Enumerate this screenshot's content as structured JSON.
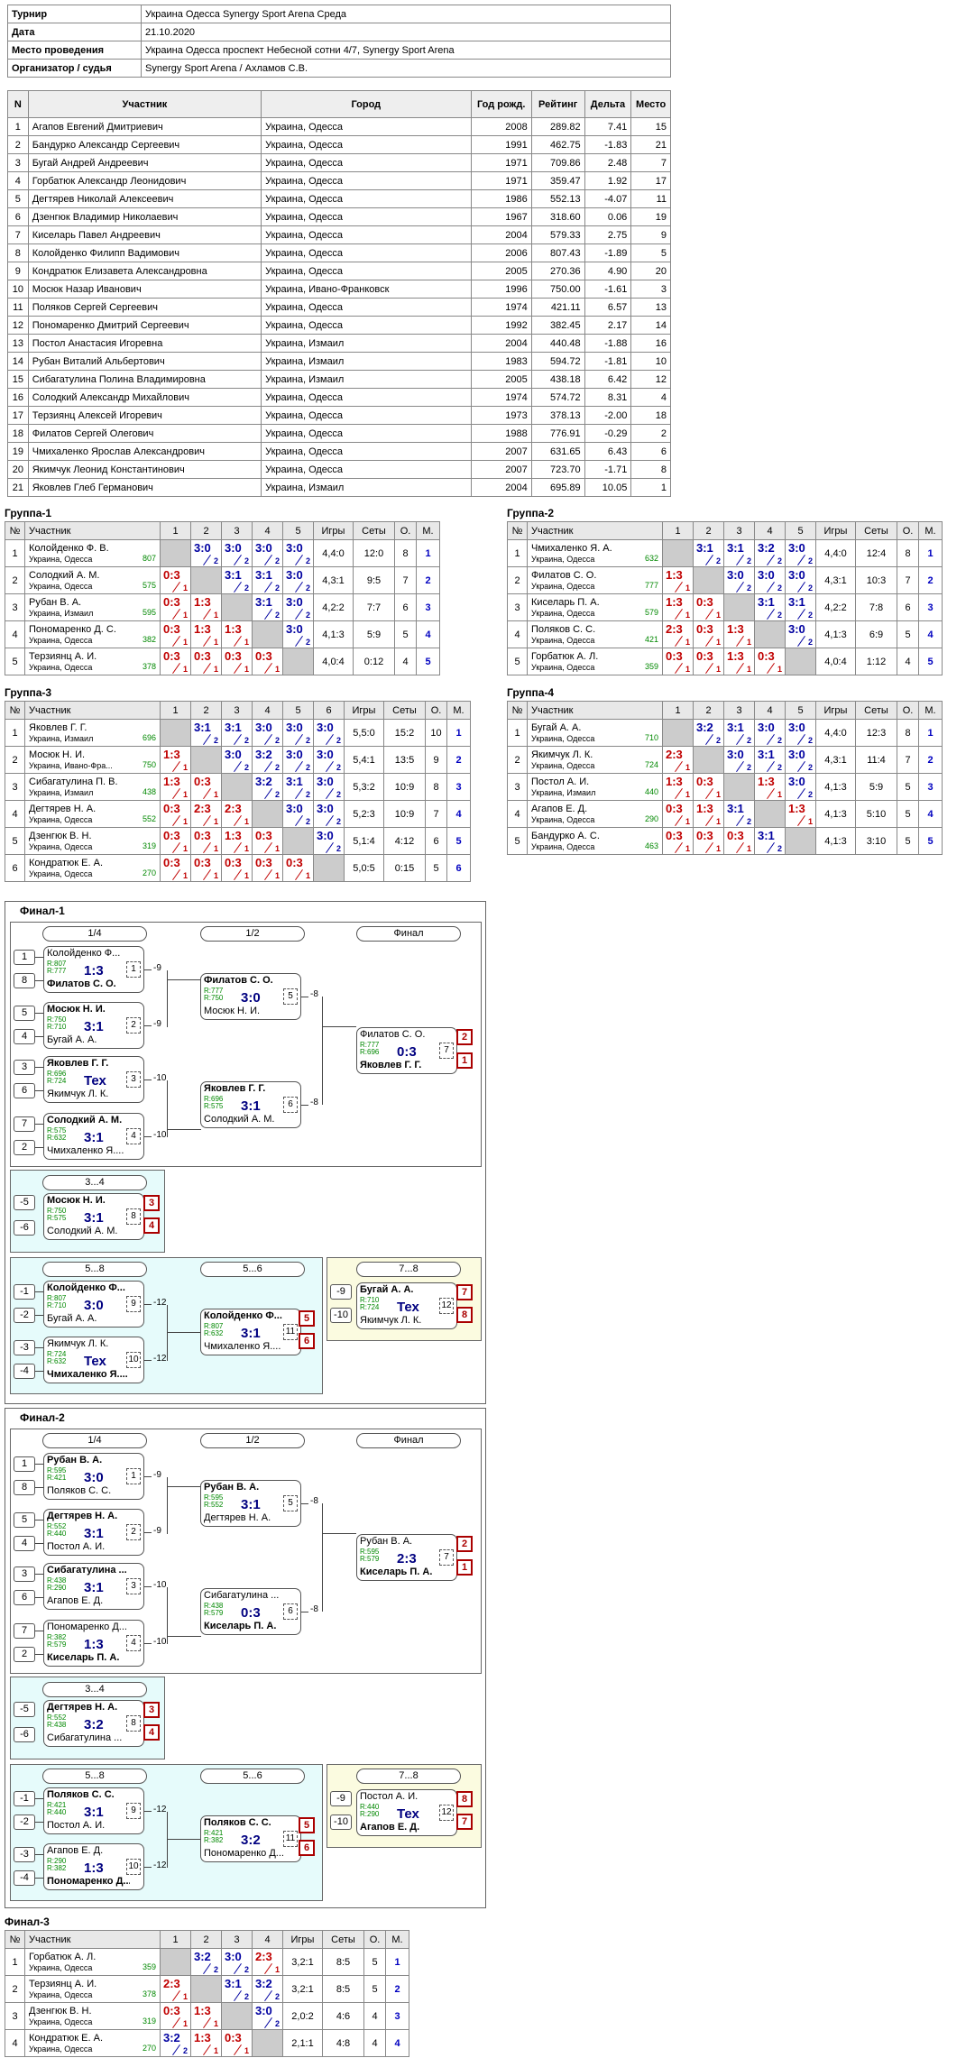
{
  "info": [
    [
      "Турнир",
      "Украина Одесса Synergy Sport Arena Среда"
    ],
    [
      "Дата",
      "21.10.2020"
    ],
    [
      "Место проведения",
      "Украина Одесса проспект Небесной сотни 4/7, Synergy Sport Arena"
    ],
    [
      "Организатор / судья",
      "Synergy Sport Arena / Ахламов С.В."
    ]
  ],
  "participants_header": [
    "N",
    "Участник",
    "Город",
    "Год рожд.",
    "Рейтинг",
    "Дельта",
    "Место"
  ],
  "participants": [
    [
      "1",
      "Агапов Евгений Дмитриевич",
      "Украина, Одесса",
      "2008",
      "289.82",
      "7.41",
      "15"
    ],
    [
      "2",
      "Бандурко Александр Сергеевич",
      "Украина, Одесса",
      "1991",
      "462.75",
      "-1.83",
      "21"
    ],
    [
      "3",
      "Бугай Андрей Андреевич",
      "Украина, Одесса",
      "1971",
      "709.86",
      "2.48",
      "7"
    ],
    [
      "4",
      "Горбатюк Александр Леонидович",
      "Украина, Одесса",
      "1971",
      "359.47",
      "1.92",
      "17"
    ],
    [
      "5",
      "Дегтярев Николай Алексеевич",
      "Украина, Одесса",
      "1986",
      "552.13",
      "-4.07",
      "11"
    ],
    [
      "6",
      "Дзенгюк Владимир Николаевич",
      "Украина, Одесса",
      "1967",
      "318.60",
      "0.06",
      "19"
    ],
    [
      "7",
      "Киселарь Павел Андреевич",
      "Украина, Одесса",
      "2004",
      "579.33",
      "2.75",
      "9"
    ],
    [
      "8",
      "Колойденко Филипп Вадимович",
      "Украина, Одесса",
      "2006",
      "807.43",
      "-1.89",
      "5"
    ],
    [
      "9",
      "Кондратюк Елизавета Александровна",
      "Украина, Одесса",
      "2005",
      "270.36",
      "4.90",
      "20"
    ],
    [
      "10",
      "Мосюк Назар Иванович",
      "Украина, Ивано-Франковск",
      "1996",
      "750.00",
      "-1.61",
      "3"
    ],
    [
      "11",
      "Поляков Сергей Сергеевич",
      "Украина, Одесса",
      "1974",
      "421.11",
      "6.57",
      "13"
    ],
    [
      "12",
      "Пономаренко Дмитрий Сергеевич",
      "Украина, Одесса",
      "1992",
      "382.45",
      "2.17",
      "14"
    ],
    [
      "13",
      "Постол Анастасия Игоревна",
      "Украина, Измаил",
      "2004",
      "440.48",
      "-1.88",
      "16"
    ],
    [
      "14",
      "Рубан Виталий Альбертович",
      "Украина, Измаил",
      "1983",
      "594.72",
      "-1.81",
      "10"
    ],
    [
      "15",
      "Сибагатулина Полина Владимировна",
      "Украина, Измаил",
      "2005",
      "438.18",
      "6.42",
      "12"
    ],
    [
      "16",
      "Солодкий Александр Михайлович",
      "Украина, Одесса",
      "1974",
      "574.72",
      "8.31",
      "4"
    ],
    [
      "17",
      "Терзиянц Алексей Игоревич",
      "Украина, Одесса",
      "1973",
      "378.13",
      "-2.00",
      "18"
    ],
    [
      "18",
      "Филатов Сергей Олегович",
      "Украина, Одесса",
      "1988",
      "776.91",
      "-0.29",
      "2"
    ],
    [
      "19",
      "Чмихаленко Ярослав Александрович",
      "Украина, Одесса",
      "2007",
      "631.65",
      "6.43",
      "6"
    ],
    [
      "20",
      "Якимчук Леонид Константинович",
      "Украина, Одесса",
      "2007",
      "723.70",
      "-1.71",
      "8"
    ],
    [
      "21",
      "Яковлев Глеб Германович",
      "Украина, Измаил",
      "2004",
      "695.89",
      "10.05",
      "1"
    ]
  ],
  "group_cols": {
    "num": "№",
    "name": "Участник",
    "games": "Игры",
    "sets": "Сеты",
    "points": "О.",
    "place": "М."
  },
  "groups": [
    {
      "title": "Группа-1",
      "rows": [
        {
          "n": "1",
          "name": "Колойденко Ф. В.",
          "city": "Украина, Одесса",
          "r": "807",
          "res": [
            null,
            "3:0",
            "3:0",
            "3:0",
            "3:0"
          ],
          "games": "4,4:0",
          "sets": "12:0",
          "pts": "8",
          "place": "1"
        },
        {
          "n": "2",
          "name": "Солодкий А. М.",
          "city": "Украина, Одесса",
          "r": "575",
          "res": [
            "0:3",
            null,
            "3:1",
            "3:1",
            "3:0"
          ],
          "games": "4,3:1",
          "sets": "9:5",
          "pts": "7",
          "place": "2"
        },
        {
          "n": "3",
          "name": "Рубан В. А.",
          "city": "Украина, Измаил",
          "r": "595",
          "res": [
            "0:3",
            "1:3",
            null,
            "3:1",
            "3:0"
          ],
          "games": "4,2:2",
          "sets": "7:7",
          "pts": "6",
          "place": "3"
        },
        {
          "n": "4",
          "name": "Пономаренко Д. С.",
          "city": "Украина, Одесса",
          "r": "382",
          "res": [
            "0:3",
            "1:3",
            "1:3",
            null,
            "3:0"
          ],
          "games": "4,1:3",
          "sets": "5:9",
          "pts": "5",
          "place": "4"
        },
        {
          "n": "5",
          "name": "Терзиянц А. И.",
          "city": "Украина, Одесса",
          "r": "378",
          "res": [
            "0:3",
            "0:3",
            "0:3",
            "0:3",
            null
          ],
          "games": "4,0:4",
          "sets": "0:12",
          "pts": "4",
          "place": "5"
        }
      ]
    },
    {
      "title": "Группа-2",
      "rows": [
        {
          "n": "1",
          "name": "Чмихаленко Я. А.",
          "city": "Украина, Одесса",
          "r": "632",
          "res": [
            null,
            "3:1",
            "3:1",
            "3:2",
            "3:0"
          ],
          "games": "4,4:0",
          "sets": "12:4",
          "pts": "8",
          "place": "1"
        },
        {
          "n": "2",
          "name": "Филатов С. О.",
          "city": "Украина, Одесса",
          "r": "777",
          "res": [
            "1:3",
            null,
            "3:0",
            "3:0",
            "3:0"
          ],
          "games": "4,3:1",
          "sets": "10:3",
          "pts": "7",
          "place": "2"
        },
        {
          "n": "3",
          "name": "Киселарь П. А.",
          "city": "Украина, Одесса",
          "r": "579",
          "res": [
            "1:3",
            "0:3",
            null,
            "3:1",
            "3:1"
          ],
          "games": "4,2:2",
          "sets": "7:8",
          "pts": "6",
          "place": "3"
        },
        {
          "n": "4",
          "name": "Поляков С. С.",
          "city": "Украина, Одесса",
          "r": "421",
          "res": [
            "2:3",
            "0:3",
            "1:3",
            null,
            "3:0"
          ],
          "games": "4,1:3",
          "sets": "6:9",
          "pts": "5",
          "place": "4"
        },
        {
          "n": "5",
          "name": "Горбатюк А. Л.",
          "city": "Украина, Одесса",
          "r": "359",
          "res": [
            "0:3",
            "0:3",
            "1:3",
            "0:3",
            null
          ],
          "games": "4,0:4",
          "sets": "1:12",
          "pts": "4",
          "place": "5"
        }
      ]
    },
    {
      "title": "Группа-3",
      "rows": [
        {
          "n": "1",
          "name": "Яковлев Г. Г.",
          "city": "Украина, Измаил",
          "r": "696",
          "res": [
            null,
            "3:1",
            "3:1",
            "3:0",
            "3:0",
            "3:0"
          ],
          "games": "5,5:0",
          "sets": "15:2",
          "pts": "10",
          "place": "1"
        },
        {
          "n": "2",
          "name": "Мосюк Н. И.",
          "city": "Украина, Ивано-Фра...",
          "r": "750",
          "res": [
            "1:3",
            null,
            "3:0",
            "3:2",
            "3:0",
            "3:0"
          ],
          "games": "5,4:1",
          "sets": "13:5",
          "pts": "9",
          "place": "2"
        },
        {
          "n": "3",
          "name": "Сибагатулина П. В.",
          "city": "Украина, Измаил",
          "r": "438",
          "res": [
            "1:3",
            "0:3",
            null,
            "3:2",
            "3:1",
            "3:0"
          ],
          "games": "5,3:2",
          "sets": "10:9",
          "pts": "8",
          "place": "3"
        },
        {
          "n": "4",
          "name": "Дегтярев Н. А.",
          "city": "Украина, Одесса",
          "r": "552",
          "res": [
            "0:3",
            "2:3",
            "2:3",
            null,
            "3:0",
            "3:0"
          ],
          "games": "5,2:3",
          "sets": "10:9",
          "pts": "7",
          "place": "4"
        },
        {
          "n": "5",
          "name": "Дзенгюк В. Н.",
          "city": "Украина, Одесса",
          "r": "319",
          "res": [
            "0:3",
            "0:3",
            "1:3",
            "0:3",
            null,
            "3:0"
          ],
          "games": "5,1:4",
          "sets": "4:12",
          "pts": "6",
          "place": "5"
        },
        {
          "n": "6",
          "name": "Кондратюк Е. А.",
          "city": "Украина, Одесса",
          "r": "270",
          "res": [
            "0:3",
            "0:3",
            "0:3",
            "0:3",
            "0:3",
            null
          ],
          "games": "5,0:5",
          "sets": "0:15",
          "pts": "5",
          "place": "6"
        }
      ]
    },
    {
      "title": "Группа-4",
      "rows": [
        {
          "n": "1",
          "name": "Бугай А. А.",
          "city": "Украина, Одесса",
          "r": "710",
          "res": [
            null,
            "3:2",
            "3:1",
            "3:0",
            "3:0"
          ],
          "games": "4,4:0",
          "sets": "12:3",
          "pts": "8",
          "place": "1"
        },
        {
          "n": "2",
          "name": "Якимчук Л. К.",
          "city": "Украина, Одесса",
          "r": "724",
          "res": [
            "2:3",
            null,
            "3:0",
            "3:1",
            "3:0"
          ],
          "games": "4,3:1",
          "sets": "11:4",
          "pts": "7",
          "place": "2"
        },
        {
          "n": "3",
          "name": "Постол А. И.",
          "city": "Украина, Измаил",
          "r": "440",
          "res": [
            "1:3",
            "0:3",
            null,
            "1:3",
            "3:0"
          ],
          "games": "4,1:3",
          "sets": "5:9",
          "pts": "5",
          "place": "3"
        },
        {
          "n": "4",
          "name": "Агапов Е. Д.",
          "city": "Украина, Одесса",
          "r": "290",
          "res": [
            "0:3",
            "1:3",
            "3:1",
            null,
            "1:3"
          ],
          "games": "4,1:3",
          "sets": "5:10",
          "pts": "5",
          "place": "4"
        },
        {
          "n": "5",
          "name": "Бандурко А. С.",
          "city": "Украина, Одесса",
          "r": "463",
          "res": [
            "0:3",
            "0:3",
            "0:3",
            "3:1",
            null
          ],
          "games": "4,1:3",
          "sets": "3:10",
          "pts": "5",
          "place": "5"
        }
      ]
    },
    {
      "title": "Финал-3",
      "rows": [
        {
          "n": "1",
          "name": "Горбатюк А. Л.",
          "city": "Украина, Одесса",
          "r": "359",
          "res": [
            null,
            "3:2",
            "3:0",
            "2:3"
          ],
          "games": "3,2:1",
          "sets": "8:5",
          "pts": "5",
          "place": "1"
        },
        {
          "n": "2",
          "name": "Терзиянц А. И.",
          "city": "Украина, Одесса",
          "r": "378",
          "res": [
            "2:3",
            null,
            "3:1",
            "3:2"
          ],
          "games": "3,2:1",
          "sets": "8:5",
          "pts": "5",
          "place": "2"
        },
        {
          "n": "3",
          "name": "Дзенгюк В. Н.",
          "city": "Украина, Одесса",
          "r": "319",
          "res": [
            "0:3",
            "1:3",
            null,
            "3:0"
          ],
          "games": "2,0:2",
          "sets": "4:6",
          "pts": "4",
          "place": "3"
        },
        {
          "n": "4",
          "name": "Кондратюк Е. А.",
          "city": "Украина, Одесса",
          "r": "270",
          "res": [
            "3:2",
            "1:3",
            "0:3",
            null
          ],
          "games": "2,1:1",
          "sets": "4:8",
          "pts": "4",
          "place": "4"
        }
      ]
    }
  ],
  "finals": [
    {
      "title": "Финал-1",
      "headers": {
        "q": "1/4",
        "s": "1/2",
        "f": "Финал",
        "p34": "3...4",
        "p58": "5...8",
        "p56": "5...6",
        "p78": "7...8"
      },
      "seeds": [
        "1",
        "8",
        "5",
        "4",
        "3",
        "6",
        "7",
        "2"
      ],
      "lose_seeds": [
        "-5",
        "-6",
        "-1",
        "-2",
        "-3",
        "-4",
        "-9",
        "-10"
      ],
      "links": [
        "-9",
        "-9",
        "-10",
        "-10",
        "-8",
        "-8",
        "-12",
        "-12"
      ],
      "matches": [
        {
          "p1": "Колойденко Ф...",
          "p2": "Филатов С. О.",
          "r1": "R:807",
          "r2": "R:777",
          "score": "1:3",
          "num": "1",
          "win": 2
        },
        {
          "p1": "Мосюк Н. И.",
          "p2": "Бугай А. А.",
          "r1": "R:750",
          "r2": "R:710",
          "score": "3:1",
          "num": "2",
          "win": 1
        },
        {
          "p1": "Яковлев Г. Г.",
          "p2": "Якимчук Л. К.",
          "r1": "R:696",
          "r2": "R:724",
          "score": "Тех",
          "num": "3",
          "win": 1
        },
        {
          "p1": "Солодкий А. М.",
          "p2": "Чмихаленко Я....",
          "r1": "R:575",
          "r2": "R:632",
          "score": "3:1",
          "num": "4",
          "win": 1
        },
        {
          "p1": "Филатов С. О.",
          "p2": "Мосюк Н. И.",
          "r1": "R:777",
          "r2": "R:750",
          "score": "3:0",
          "num": "5",
          "win": 1
        },
        {
          "p1": "Яковлев Г. Г.",
          "p2": "Солодкий А. М.",
          "r1": "R:696",
          "r2": "R:575",
          "score": "3:1",
          "num": "6",
          "win": 1
        },
        {
          "p1": "Филатов С. О.",
          "p2": "Яковлев Г. Г.",
          "r1": "R:777",
          "r2": "R:696",
          "score": "0:3",
          "num": "7",
          "win": 2
        },
        {
          "p1": "Мосюк Н. И.",
          "p2": "Солодкий А. М.",
          "r1": "R:750",
          "r2": "R:575",
          "score": "3:1",
          "num": "8",
          "win": 1
        },
        {
          "p1": "Колойденко Ф...",
          "p2": "Бугай А. А.",
          "r1": "R:807",
          "r2": "R:710",
          "score": "3:0",
          "num": "9",
          "win": 1
        },
        {
          "p1": "Якимчук Л. К.",
          "p2": "Чмихаленко Я....",
          "r1": "R:724",
          "r2": "R:632",
          "score": "Тех",
          "num": "10",
          "win": 2
        },
        {
          "p1": "Колойденко Ф...",
          "p2": "Чмихаленко Я....",
          "r1": "R:807",
          "r2": "R:632",
          "score": "3:1",
          "num": "11",
          "win": 1
        },
        {
          "p1": "Бугай А. А.",
          "p2": "Якимчук Л. К.",
          "r1": "R:710",
          "r2": "R:724",
          "score": "Тех",
          "num": "12",
          "win": 1
        }
      ],
      "places": {
        "f": [
          "2",
          "1"
        ],
        "p34": [
          "3",
          "4"
        ],
        "p56": [
          "5",
          "6"
        ],
        "p78": [
          "7",
          "8"
        ]
      }
    },
    {
      "title": "Финал-2",
      "headers": {
        "q": "1/4",
        "s": "1/2",
        "f": "Финал",
        "p34": "3...4",
        "p58": "5...8",
        "p56": "5...6",
        "p78": "7...8"
      },
      "seeds": [
        "1",
        "8",
        "5",
        "4",
        "3",
        "6",
        "7",
        "2"
      ],
      "lose_seeds": [
        "-5",
        "-6",
        "-1",
        "-2",
        "-3",
        "-4",
        "-9",
        "-10"
      ],
      "links": [
        "-9",
        "-9",
        "-10",
        "-10",
        "-8",
        "-8",
        "-12",
        "-12"
      ],
      "matches": [
        {
          "p1": "Рубан В. А.",
          "p2": "Поляков С. С.",
          "r1": "R:595",
          "r2": "R:421",
          "score": "3:0",
          "num": "1",
          "win": 1
        },
        {
          "p1": "Дегтярев Н. А.",
          "p2": "Постол А. И.",
          "r1": "R:552",
          "r2": "R:440",
          "score": "3:1",
          "num": "2",
          "win": 1
        },
        {
          "p1": "Сибагатулина ...",
          "p2": "Агапов Е. Д.",
          "r1": "R:438",
          "r2": "R:290",
          "score": "3:1",
          "num": "3",
          "win": 1
        },
        {
          "p1": "Пономаренко Д...",
          "p2": "Киселарь П. А.",
          "r1": "R:382",
          "r2": "R:579",
          "score": "1:3",
          "num": "4",
          "win": 2
        },
        {
          "p1": "Рубан В. А.",
          "p2": "Дегтярев Н. А.",
          "r1": "R:595",
          "r2": "R:552",
          "score": "3:1",
          "num": "5",
          "win": 1
        },
        {
          "p1": "Сибагатулина ...",
          "p2": "Киселарь П. А.",
          "r1": "R:438",
          "r2": "R:579",
          "score": "0:3",
          "num": "6",
          "win": 2
        },
        {
          "p1": "Рубан В. А.",
          "p2": "Киселарь П. А.",
          "r1": "R:595",
          "r2": "R:579",
          "score": "2:3",
          "num": "7",
          "win": 2
        },
        {
          "p1": "Дегтярев Н. А.",
          "p2": "Сибагатулина ...",
          "r1": "R:552",
          "r2": "R:438",
          "score": "3:2",
          "num": "8",
          "win": 1
        },
        {
          "p1": "Поляков С. С.",
          "p2": "Постол А. И.",
          "r1": "R:421",
          "r2": "R:440",
          "score": "3:1",
          "num": "9",
          "win": 1
        },
        {
          "p1": "Агапов Е. Д.",
          "p2": "Пономаренко Д...",
          "r1": "R:290",
          "r2": "R:382",
          "score": "1:3",
          "num": "10",
          "win": 2
        },
        {
          "p1": "Поляков С. С.",
          "p2": "Пономаренко Д...",
          "r1": "R:421",
          "r2": "R:382",
          "score": "3:2",
          "num": "11",
          "win": 1
        },
        {
          "p1": "Постол А. И.",
          "p2": "Агапов Е. Д.",
          "r1": "R:440",
          "r2": "R:290",
          "score": "Тех",
          "num": "12",
          "win": 2
        }
      ],
      "places": {
        "f": [
          "2",
          "1"
        ],
        "p34": [
          "3",
          "4"
        ],
        "p56": [
          "5",
          "6"
        ],
        "p78": [
          "8",
          "7"
        ]
      }
    }
  ]
}
